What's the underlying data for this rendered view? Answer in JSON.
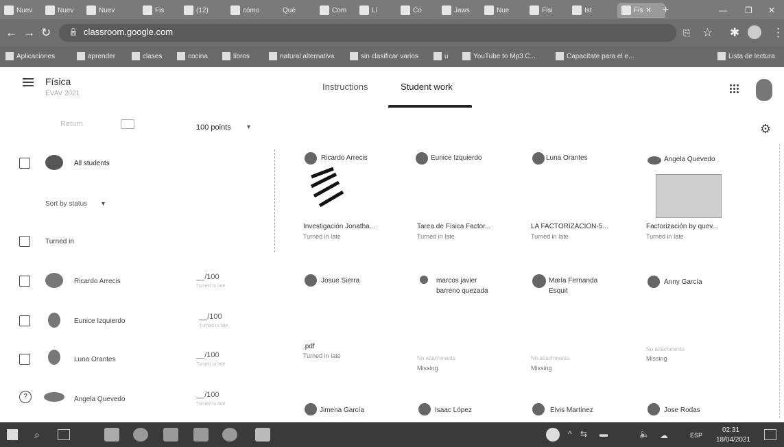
{
  "browser": {
    "tabs": [
      {
        "label": "Nuev"
      },
      {
        "label": "Nuev"
      },
      {
        "label": "Nuev"
      },
      {
        "label": "Fis"
      },
      {
        "label": "(12)"
      },
      {
        "label": "cómo"
      },
      {
        "label": "Qué"
      },
      {
        "label": "Com"
      },
      {
        "label": "Lí"
      },
      {
        "label": "Co"
      },
      {
        "label": "Jaws"
      },
      {
        "label": "Nue"
      },
      {
        "label": "Fisi"
      },
      {
        "label": "Ist"
      },
      {
        "label": "Fis"
      }
    ],
    "new_tab": "+",
    "url": "classroom.google.com",
    "bookmarks": [
      "Aplicaciones",
      "aprender",
      "clases",
      "cocina",
      "libros",
      "natural alternativa",
      "sin clasificar varios",
      "u",
      "YouTube to Mp3 C...",
      "Capacítate para el e..."
    ],
    "reading_list": "Lista de lectura"
  },
  "classroom": {
    "course_title": "Física",
    "course_subtitle": "EVAV 2021",
    "tabs": {
      "instructions": "Instructions",
      "student_work": "Student work"
    }
  },
  "toolbar": {
    "return_label": "Return",
    "points_label": "100 points"
  },
  "sidebar": {
    "all_students": "All students",
    "sort_label": "Sort by status",
    "turned_in_label": "Turned in",
    "students": [
      {
        "name": "Ricardo Arrecis",
        "grade": "__/100",
        "sub": "Turned in late"
      },
      {
        "name": "Eunice Izquierdo",
        "grade": "__/100",
        "sub": "Turned in late"
      },
      {
        "name": "Luna Orantes",
        "grade": "__/100",
        "sub": "Turned in late"
      },
      {
        "name": "Angela Quevedo",
        "grade": "__/100",
        "sub": "Turned in late"
      }
    ]
  },
  "grid": {
    "cards": [
      {
        "name": "Ricardo Arrecis",
        "file": "Investigación Jonatha...",
        "status": "Turned in late"
      },
      {
        "name": "Eunice Izquierdo",
        "file": "Tarea de Física Factor...",
        "status": "Turned in late"
      },
      {
        "name": "Luna Orantes",
        "file": "LA FACTORIZACION-5...",
        "status": "Turned in late"
      },
      {
        "name": "Angela Quevedo",
        "file": "Factorización by quev...",
        "status": "Turned in late"
      },
      {
        "name": "Josue Sierra",
        "file": ".pdf",
        "status": "Turned in late"
      },
      {
        "name": "marcos javier barreno quezada",
        "sub": "No attachments",
        "status": "Missing"
      },
      {
        "name": "María Fernanda Esquit",
        "sub": "No attachments",
        "status": "Missing"
      },
      {
        "name": "Anny García",
        "sub": "No attachments",
        "status": "Missing"
      },
      {
        "name": "Jimena García"
      },
      {
        "name": "Isaac López"
      },
      {
        "name": "Elvis Martínez"
      },
      {
        "name": "Jose Rodas"
      }
    ]
  },
  "taskbar": {
    "lang": "ESP",
    "time": "02:31",
    "date": "18/04/2021"
  }
}
